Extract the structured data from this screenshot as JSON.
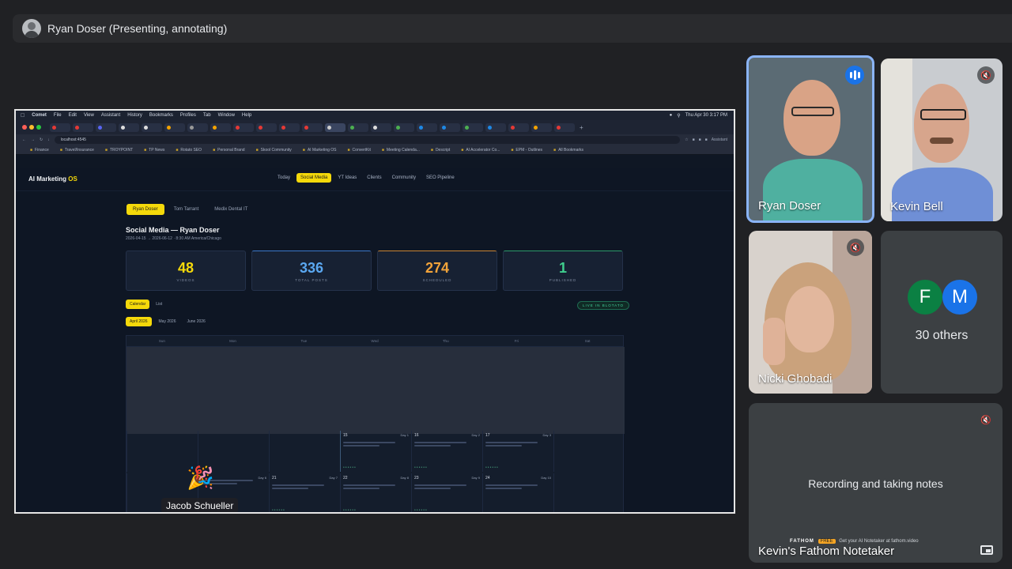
{
  "presenter": {
    "label": "Ryan Doser (Presenting, annotating)"
  },
  "mac_menu": {
    "items": [
      "Comet",
      "File",
      "Edit",
      "View",
      "Assistant",
      "History",
      "Bookmarks",
      "Profiles",
      "Tab",
      "Window",
      "Help"
    ],
    "clock": "Thu Apr 30 3:17 PM"
  },
  "browser": {
    "url": "localhost:4545",
    "assistant": "Assistant",
    "bookmarks": [
      "Finance",
      "Travel/Insurance",
      "TROYPOINT",
      "TP News",
      "Rotato SEO",
      "Personal Brand",
      "Skool Community",
      "AI Marketing OS",
      "ConvertKit",
      "Meeting Calenda...",
      "Descript",
      "AI Accelerator Co...",
      "EPM - Outlines",
      "All Bookmarks"
    ]
  },
  "app": {
    "brand": "AI Marketing",
    "brand_accent": "OS",
    "nav": [
      "Today",
      "Social Media",
      "YT Ideas",
      "Clients",
      "Community",
      "SEO Pipeline"
    ],
    "client_tabs": [
      "Ryan Doser",
      "Tom Tarrant",
      "Medix Dental IT"
    ],
    "title": "Social Media — Ryan Doser",
    "subtitle": "2026-04-15 → 2026-06-12 · 8:30 AM America/Chicago",
    "stats": [
      {
        "value": "48",
        "label": "VIDEOS",
        "color": "#f5d90a"
      },
      {
        "value": "336",
        "label": "TOTAL POSTS",
        "color": "#5aa7f0"
      },
      {
        "value": "274",
        "label": "SCHEDULED",
        "color": "#f2a33a"
      },
      {
        "value": "1",
        "label": "PUBLISHED",
        "color": "#3fcf8e"
      }
    ],
    "views": [
      "Calendar",
      "List"
    ],
    "live_pill": "LIVE IN BLOTATO",
    "months": [
      "April 2026",
      "May 2026",
      "June 2026"
    ],
    "weekdays": [
      "Sun",
      "Mon",
      "Tue",
      "Wed",
      "Thu",
      "Fri",
      "Sat"
    ],
    "week1": [
      {
        "day": "",
        "tag": ""
      },
      {
        "day": "",
        "tag": ""
      },
      {
        "day": "",
        "tag": ""
      },
      {
        "day": "15",
        "tag": "Day 1"
      },
      {
        "day": "16",
        "tag": "Day 2"
      },
      {
        "day": "17",
        "tag": "Day 3"
      },
      {
        "day": "",
        "tag": ""
      }
    ],
    "week2": [
      {
        "day": "",
        "tag": ""
      },
      {
        "day": "",
        "tag": "Day 6"
      },
      {
        "day": "21",
        "tag": "Day 7"
      },
      {
        "day": "22",
        "tag": "Day 8"
      },
      {
        "day": "23",
        "tag": "Day 9"
      },
      {
        "day": "24",
        "tag": "Day 10"
      },
      {
        "day": "",
        "tag": ""
      }
    ]
  },
  "screen_overlay_name": "Jacob Schueller",
  "participants": [
    {
      "name": "Ryan Doser",
      "speaking": true
    },
    {
      "name": "Kevin Bell",
      "muted": true
    },
    {
      "name": "Nicki Ghobadi",
      "muted": true
    }
  ],
  "others": {
    "initials": [
      "F",
      "M"
    ],
    "label": "30 others",
    "colors": [
      "#0b8043",
      "#1a73e8"
    ]
  },
  "notetaker": {
    "status": "Recording and taking notes",
    "name": "Kevin's Fathom Notetaker",
    "brand": "FATHOM",
    "badge": "FREE",
    "footer": "Get your AI Notetaker at fathom.video"
  }
}
